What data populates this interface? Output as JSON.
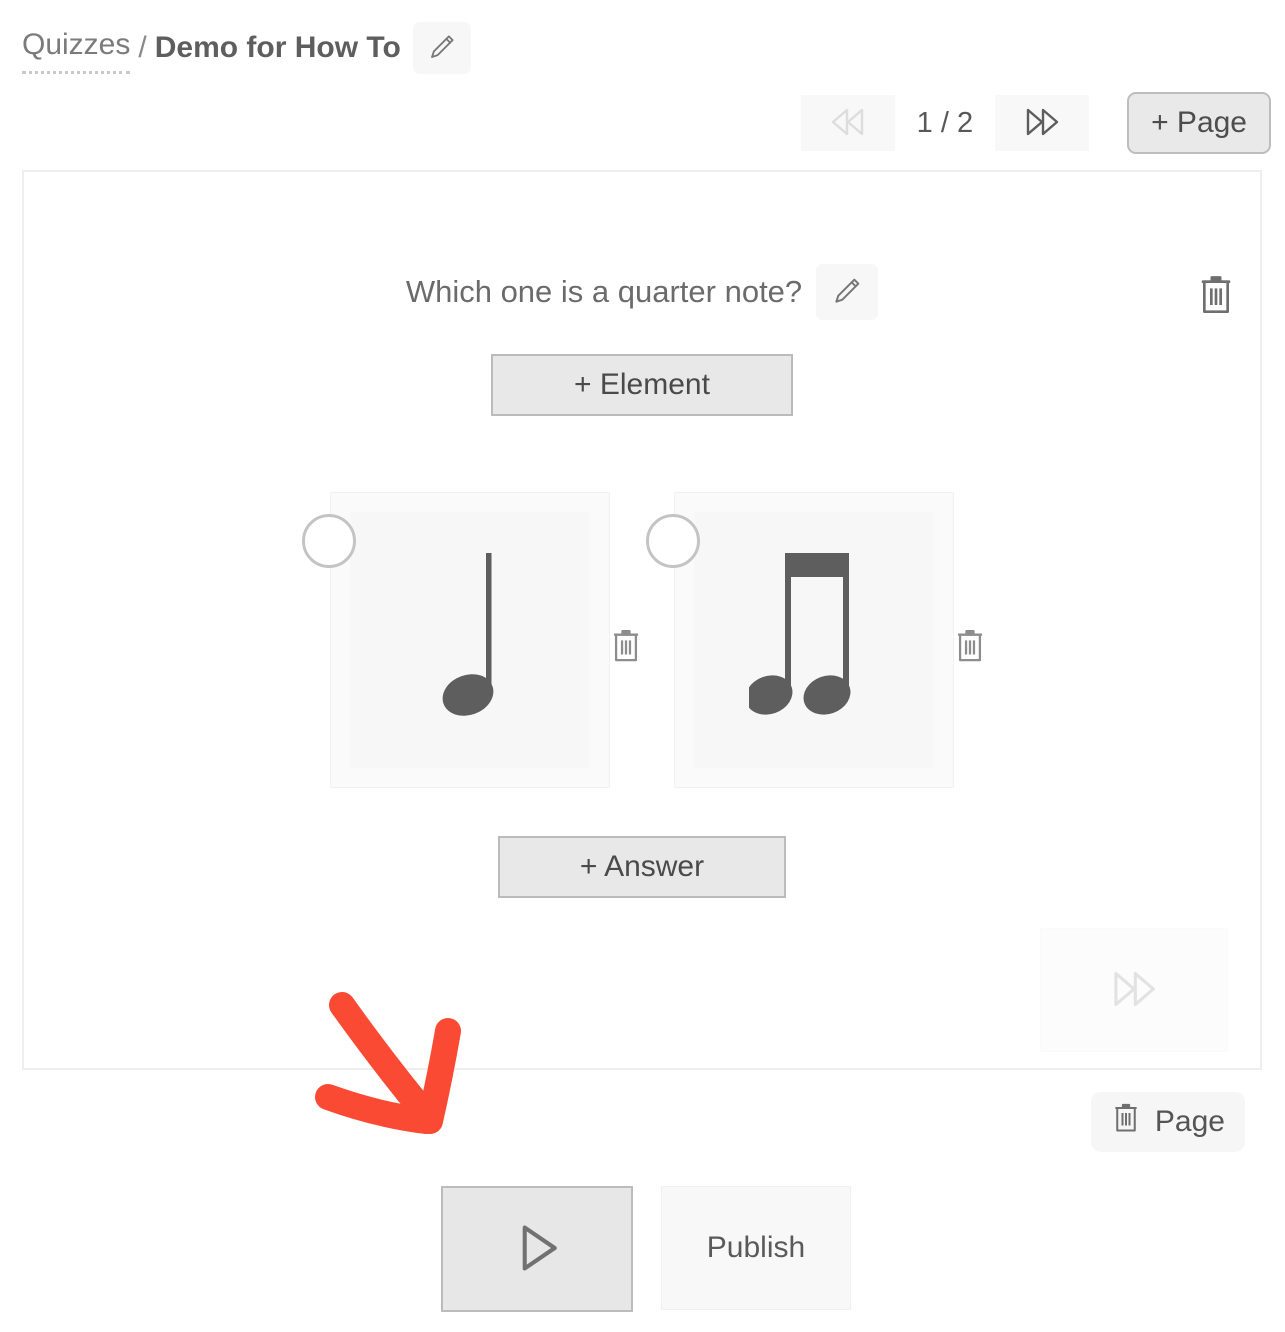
{
  "breadcrumb": {
    "parent_label": "Quizzes",
    "separator": "/",
    "current_label": "Demo for How To",
    "edit_icon": "pencil-icon"
  },
  "pager": {
    "prev_icon": "rewind-icon",
    "prev_disabled": true,
    "count_label": "1 / 2",
    "current_page": 1,
    "total_pages": 2,
    "next_icon": "fast-forward-icon",
    "add_page_label": "+ Page"
  },
  "canvas": {
    "question": {
      "text": "Which one is a quarter note?",
      "edit_icon": "pencil-icon",
      "delete_icon": "trash-icon"
    },
    "add_element_label": "+ Element",
    "add_answer_label": "+ Answer",
    "options": [
      {
        "symbol": "quarter-note",
        "selected": false,
        "radio_name": "answer-radio",
        "delete_icon": "trash-icon"
      },
      {
        "symbol": "beamed-eighth-notes",
        "selected": false,
        "radio_name": "answer-radio",
        "delete_icon": "trash-icon"
      }
    ],
    "next_icon": "fast-forward-icon"
  },
  "delete_page": {
    "label": "Page",
    "icon": "trash-icon"
  },
  "footer": {
    "play_icon": "play-icon",
    "publish_label": "Publish"
  },
  "annotation": {
    "shape": "hand-drawn-arrow",
    "direction": "down-right",
    "color": "#FB4A33"
  },
  "colors": {
    "accent_annotation": "#FB4A33",
    "text_primary": "#5a5a5a",
    "text_muted": "#8a8a8a",
    "note_fill": "#5e5e5e",
    "button_face": "#e8e8e8",
    "button_border": "#bbbbbb",
    "card_bg": "#fafafa",
    "panel_bg": "#f7f7f7"
  }
}
